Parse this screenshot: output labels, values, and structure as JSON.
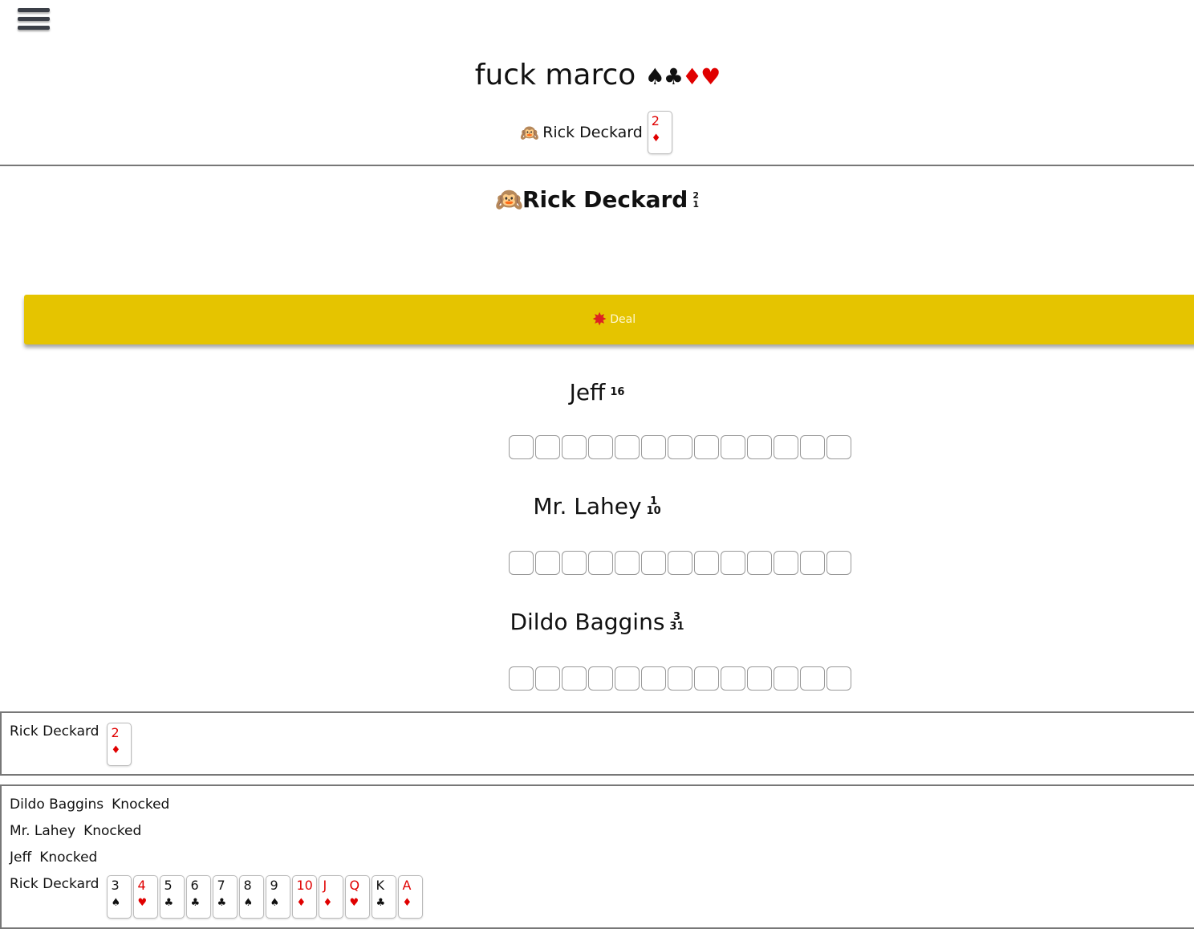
{
  "header": {
    "menu_icon": "hamburger-icon",
    "title": "fuck marco",
    "title_suits": [
      {
        "glyph": "♠",
        "color": "#111111"
      },
      {
        "glyph": "♣",
        "color": "#111111"
      },
      {
        "glyph": "♦",
        "color": "#e00000"
      },
      {
        "glyph": "♥",
        "color": "#e00000"
      }
    ]
  },
  "current_play": {
    "icon": "player-emoji-icon",
    "player": "Rick Deckard",
    "card": {
      "rank": "2",
      "suit": "♦",
      "color": "#e00000"
    }
  },
  "active_player": {
    "icon": "player-emoji-icon",
    "name": "Rick Deckard",
    "score_top": "2",
    "score_bottom": "1"
  },
  "deal_button": {
    "icon": "explosion-icon",
    "label": "Deal",
    "color": "#e5c400"
  },
  "opponents": [
    {
      "name": "Jeff",
      "score_top": "",
      "score_bottom": "16",
      "hidden_cards": 13
    },
    {
      "name": "Mr. Lahey",
      "score_top": "1",
      "score_bottom": "10",
      "hidden_cards": 13
    },
    {
      "name": "Dildo Baggins",
      "score_top": "3",
      "score_bottom": "31",
      "hidden_cards": 13
    }
  ],
  "table_panel": {
    "player": "Rick Deckard",
    "card": {
      "rank": "2",
      "suit": "♦",
      "color": "#e00000"
    }
  },
  "log_panel": {
    "lines": [
      {
        "player": "Dildo Baggins",
        "action": "Knocked"
      },
      {
        "player": "Mr. Lahey",
        "action": "Knocked"
      },
      {
        "player": "Jeff",
        "action": "Knocked"
      }
    ],
    "hand_player": "Rick Deckard",
    "hand": [
      {
        "rank": "3",
        "suit": "♠",
        "color": "#111111"
      },
      {
        "rank": "4",
        "suit": "♥",
        "color": "#e00000"
      },
      {
        "rank": "5",
        "suit": "♣",
        "color": "#111111"
      },
      {
        "rank": "6",
        "suit": "♣",
        "color": "#111111"
      },
      {
        "rank": "7",
        "suit": "♣",
        "color": "#111111"
      },
      {
        "rank": "8",
        "suit": "♠",
        "color": "#111111"
      },
      {
        "rank": "9",
        "suit": "♠",
        "color": "#111111"
      },
      {
        "rank": "10",
        "suit": "♦",
        "color": "#e00000"
      },
      {
        "rank": "J",
        "suit": "♦",
        "color": "#e00000"
      },
      {
        "rank": "Q",
        "suit": "♥",
        "color": "#e00000"
      },
      {
        "rank": "K",
        "suit": "♣",
        "color": "#111111"
      },
      {
        "rank": "A",
        "suit": "♦",
        "color": "#e00000"
      }
    ]
  }
}
